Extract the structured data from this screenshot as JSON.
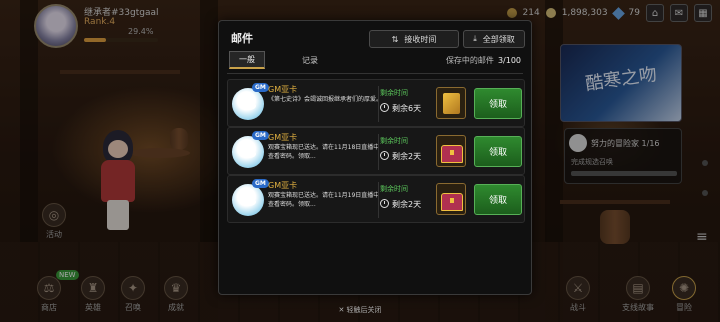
{
  "hud": {
    "player_name": "继承者#33gtgaal",
    "rank": "Rank.4",
    "exp_percent": "29.4%",
    "exp_fraction": 0.294,
    "coins": "214",
    "gold": "1,898,303",
    "gems": "79"
  },
  "mail": {
    "title": "邮件",
    "sort_button": "接收时间",
    "claim_all_button": "全部领取",
    "tabs": [
      "一般",
      "记录"
    ],
    "saved_label": "保存中的邮件",
    "saved_count": "3/100",
    "items": [
      {
        "sender": "GM亚卡",
        "badge": "GM",
        "message": "《第七史诗》会竭诚回报继承者们的厚爱。",
        "remain_label": "剩余时间",
        "remain_value": "剩余6天",
        "reward_icon": "gold-card-icon",
        "claim_label": "领取"
      },
      {
        "sender": "GM亚卡",
        "badge": "GM",
        "message": "观赛宝箱现已送达。请在11月18日直播中查看密码。领取...",
        "remain_label": "剩余时间",
        "remain_value": "剩余2天",
        "reward_icon": "chest-icon",
        "claim_label": "领取"
      },
      {
        "sender": "GM亚卡",
        "badge": "GM",
        "message": "观赛宝箱现已送达。请在11月19日直播中查看密码。领取...",
        "remain_label": "剩余时间",
        "remain_value": "剩余2天",
        "reward_icon": "chest-icon",
        "claim_label": "领取"
      }
    ],
    "close_hint": "轻触后关闭"
  },
  "side": {
    "left_top": "活动",
    "bottom": [
      "商店",
      "英雄",
      "召唤",
      "成就"
    ],
    "bottom_right": [
      "战斗",
      "支线故事",
      "冒险"
    ]
  },
  "right_panel": {
    "banner_text": "酷寒之吻",
    "quest_title": "努力的冒险家 1/16",
    "quest_sub": "完成规选召唤"
  }
}
